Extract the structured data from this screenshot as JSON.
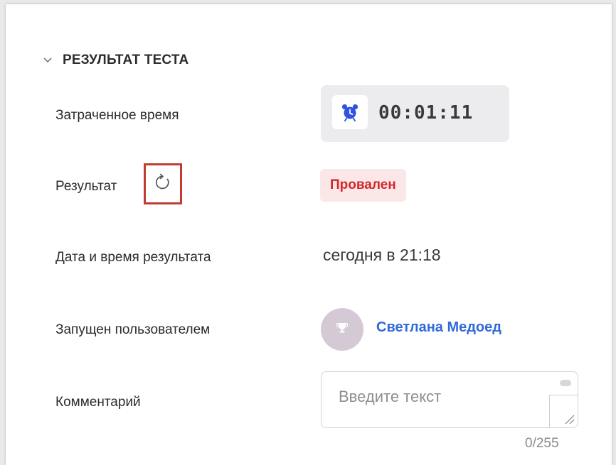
{
  "section": {
    "title": "РЕЗУЛЬТАТ ТЕСТА",
    "icon": "chevron-down-icon"
  },
  "fields": {
    "time_spent_label": "Затраченное время",
    "result_label": "Результат",
    "result_datetime_label": "Дата и время результата",
    "launched_by_label": "Запущен пользователем",
    "comment_label": "Комментарий"
  },
  "timer": {
    "value": "00:01:11",
    "icon": "alarm-clock-icon"
  },
  "result": {
    "refresh_icon": "refresh-icon",
    "status": "Провален",
    "status_color": "#d2262c",
    "status_bg": "#fbe7e7"
  },
  "result_datetime": {
    "value": "сегодня в 21:18"
  },
  "launched_by": {
    "user_name": "Светлана Медоед",
    "avatar_icon": "trophy-icon",
    "link_color": "#2f6ad9"
  },
  "comment": {
    "placeholder": "Введите текст",
    "counter": "0/255"
  },
  "colors": {
    "highlight_border": "#c23b30",
    "alarm_icon": "#2f54e0"
  }
}
